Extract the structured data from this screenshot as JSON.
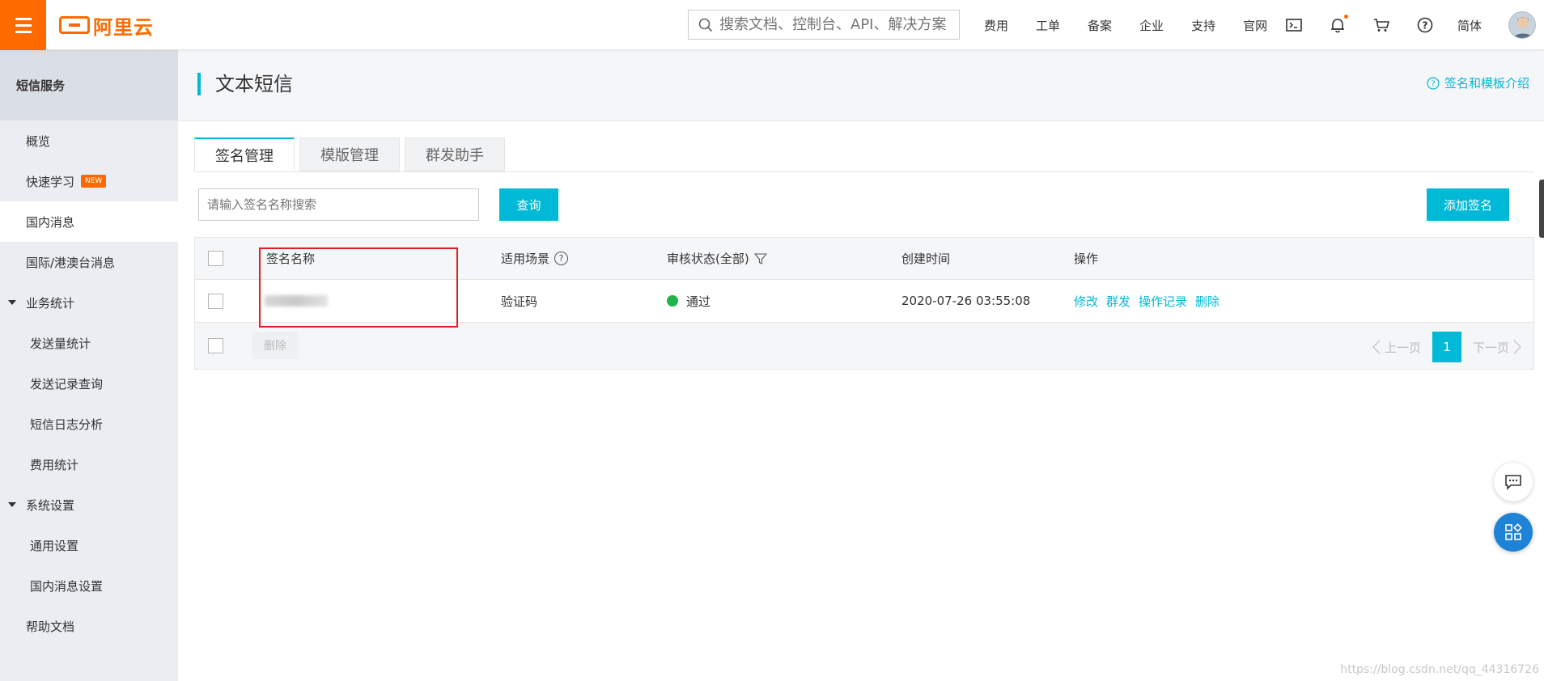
{
  "brand": {
    "logo_text": "阿里云"
  },
  "header": {
    "search_placeholder": "搜索文档、控制台、API、解决方案",
    "nav": [
      "费用",
      "工单",
      "备案",
      "企业",
      "支持",
      "官网"
    ],
    "lang": "简体"
  },
  "sidebar": {
    "title": "短信服务",
    "items": [
      {
        "label": "概览"
      },
      {
        "label": "快速学习",
        "badge": "NEW"
      },
      {
        "label": "国内消息"
      },
      {
        "label": "国际/港澳台消息"
      },
      {
        "label": "业务统计"
      },
      {
        "label": "发送量统计"
      },
      {
        "label": "发送记录查询"
      },
      {
        "label": "短信日志分析"
      },
      {
        "label": "费用统计"
      },
      {
        "label": "系统设置"
      },
      {
        "label": "通用设置"
      },
      {
        "label": "国内消息设置"
      },
      {
        "label": "帮助文档"
      }
    ]
  },
  "page": {
    "title": "文本短信",
    "help_link": "签名和模板介绍",
    "tabs": [
      "签名管理",
      "模版管理",
      "群发助手"
    ],
    "search_placeholder": "请输入签名名称搜索",
    "query_button": "查询",
    "add_button": "添加签名"
  },
  "table": {
    "columns": [
      "签名名称",
      "适用场景",
      "审核状态(全部)",
      "创建时间",
      "操作"
    ],
    "rows": [
      {
        "name": "",
        "scenario": "验证码",
        "status": "通过",
        "created": "2020-07-26 03:55:08",
        "actions": [
          "修改",
          "群发",
          "操作记录",
          "删除"
        ]
      }
    ],
    "footer": {
      "delete_button": "删除",
      "prev": "上一页",
      "page": "1",
      "next": "下一页"
    }
  },
  "watermark": "https://blog.csdn.net/qq_44316726",
  "colors": {
    "accent": "#00b9d6",
    "brand": "#ff6a00",
    "success": "#1fb34a",
    "highlight": "#e02020"
  }
}
